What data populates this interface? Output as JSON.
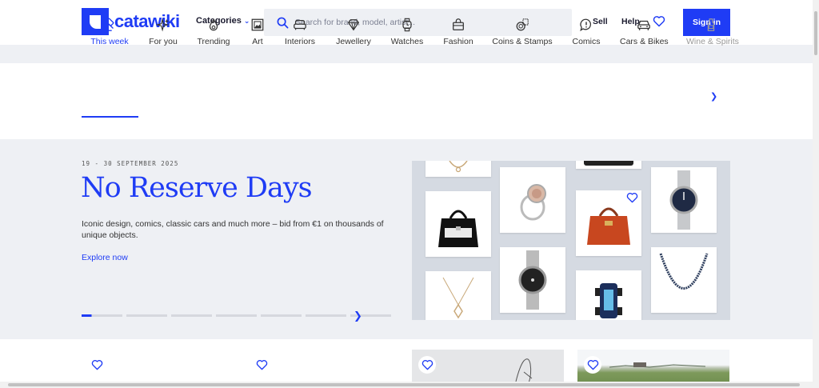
{
  "header": {
    "brand": "catawiki",
    "categories_label": "Categories",
    "search_placeholder": "Search for brand, model, artist...",
    "sell_label": "Sell",
    "help_label": "Help",
    "signin_label": "Sign in"
  },
  "categories": [
    {
      "label": "This week",
      "icon": "gavel-icon",
      "active": true
    },
    {
      "label": "For you",
      "icon": "sparkle-icon"
    },
    {
      "label": "Trending",
      "icon": "flame-icon"
    },
    {
      "label": "Art",
      "icon": "frame-icon"
    },
    {
      "label": "Interiors",
      "icon": "sofa-icon"
    },
    {
      "label": "Jewellery",
      "icon": "diamond-icon"
    },
    {
      "label": "Watches",
      "icon": "watch-icon"
    },
    {
      "label": "Fashion",
      "icon": "bag-icon"
    },
    {
      "label": "Coins & Stamps",
      "icon": "coin-icon"
    },
    {
      "label": "Comics",
      "icon": "speech-bubble-icon"
    },
    {
      "label": "Cars & Bikes",
      "icon": "car-icon"
    },
    {
      "label": "Wine & Spirits",
      "icon": "bottle-icon"
    }
  ],
  "hero": {
    "date": "19 - 30 SEPTEMBER 2025",
    "title": "No Reserve Days",
    "description": "Iconic design, comics, classic cars and much more – bid from €1 on thousands of unique objects.",
    "link": "Explore now",
    "slide_count": 7,
    "active_slide": 1
  },
  "colors": {
    "brand": "#1f3cf5",
    "background": "#eef0f4"
  }
}
